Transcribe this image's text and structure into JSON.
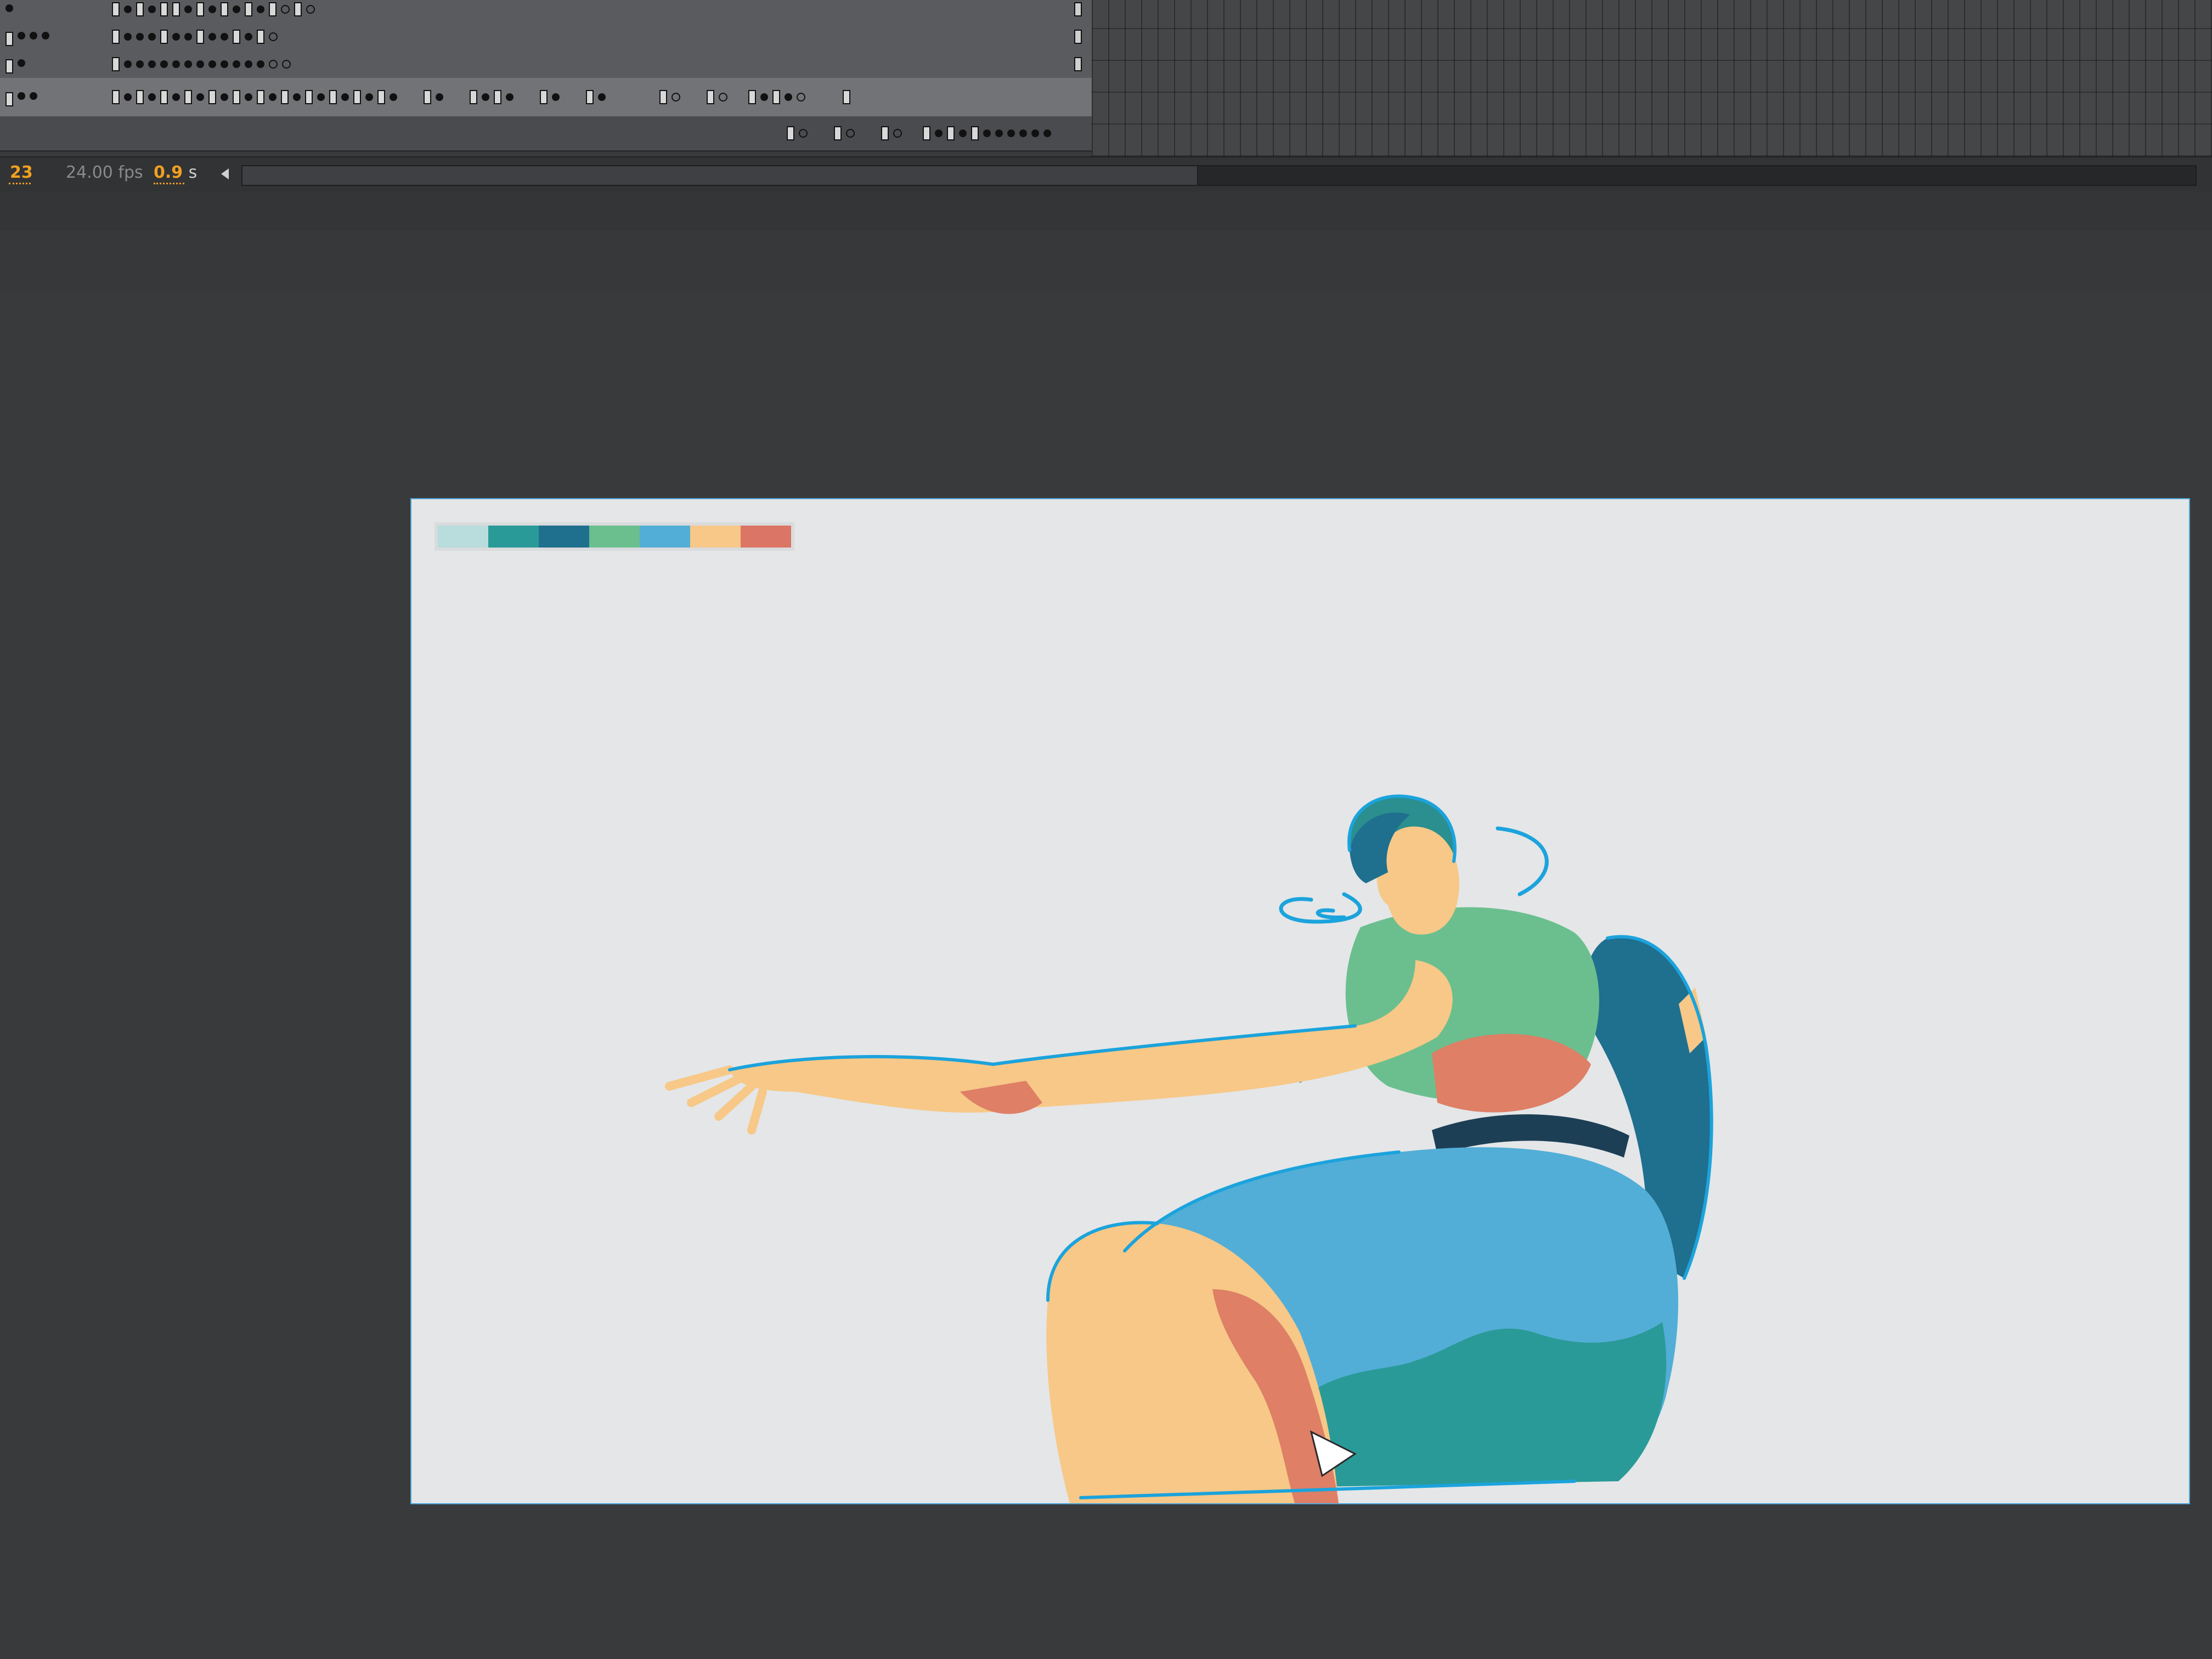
{
  "timeline": {
    "current_frame": "23",
    "fps": "24.00 fps",
    "time_value": "0.9",
    "time_unit": "s"
  },
  "palette": {
    "colors": [
      "#b9dcdc",
      "#2a9a98",
      "#1f6f8f",
      "#6bbf8e",
      "#52aed6",
      "#f7c887",
      "#db7565"
    ]
  },
  "colors": {
    "skin": "#f7c887",
    "skin_shadow": "#de7f66",
    "hair": "#2a8f8e",
    "hair_dark": "#1f6f8f",
    "top": "#6bbf8e",
    "jeans": "#52aed6",
    "jeans_dark": "#2a9a98",
    "cape": "#1f6f8f",
    "outline": "#1ba3dc",
    "stage_bg": "#e4e6e8"
  }
}
